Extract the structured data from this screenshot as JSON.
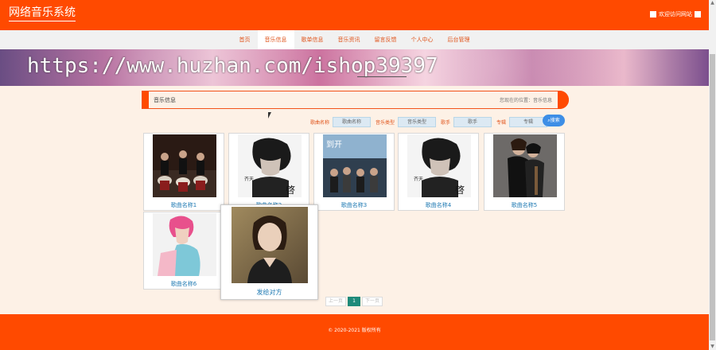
{
  "header": {
    "logo": "网络音乐系统",
    "welcome": "欢迎访问网站"
  },
  "nav": {
    "items": [
      {
        "label": "首页"
      },
      {
        "label": "音乐信息"
      },
      {
        "label": "歌单信息"
      },
      {
        "label": "音乐资讯"
      },
      {
        "label": "留言反馈"
      },
      {
        "label": "个人中心"
      },
      {
        "label": "后台管理"
      }
    ],
    "active_index": 1
  },
  "banner": {
    "watermark": "https://www.huzhan.com/ishop39397"
  },
  "section": {
    "title": "音乐信息",
    "breadcrumb": "您现在的位置：音乐信息"
  },
  "search": {
    "song_label": "歌曲名称",
    "song_placeholder": "歌曲名称",
    "type_label": "音乐类型",
    "type_placeholder": "音乐类型",
    "singer_label": "歌手",
    "singer_placeholder": "歌手",
    "album_label": "专辑",
    "album_placeholder": "专辑",
    "button": "搜索"
  },
  "songs": [
    {
      "name": "歌曲名称1",
      "icon": "drummers-photo"
    },
    {
      "name": "歌曲名称2",
      "icon": "singer-portrait-photo"
    },
    {
      "name": "歌曲名称3",
      "icon": "album-cover-photo"
    },
    {
      "name": "歌曲名称4",
      "icon": "singer-portrait-photo"
    },
    {
      "name": "歌曲名称5",
      "icon": "duo-portrait-photo"
    },
    {
      "name": "歌曲名称6",
      "icon": "singer-pink-hair-photo"
    }
  ],
  "popup_card": {
    "name": "发给对方",
    "icon": "woman-portrait-photo"
  },
  "pagination": {
    "prev": "上一页",
    "current": "1",
    "next": "下一页"
  },
  "footer": {
    "copyright": "© 2020-2021 版权所有"
  },
  "colors": {
    "brand": "#ff4a00",
    "link": "#1f7ab3",
    "page_bg": "#fdf1e6",
    "search_button": "#3d8ee6",
    "pager_current": "#1e8a7a"
  }
}
